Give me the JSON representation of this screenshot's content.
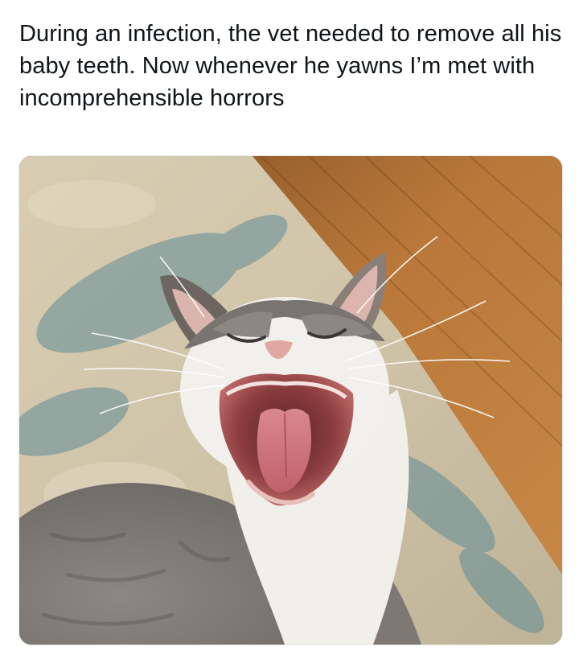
{
  "post": {
    "text": "During an infection, the vet needed to remove all his baby teeth. Now whenever he yawns I’m met with incomprehensible horrors"
  },
  "media": {
    "subject_icon": "yawning-cat-photo"
  }
}
